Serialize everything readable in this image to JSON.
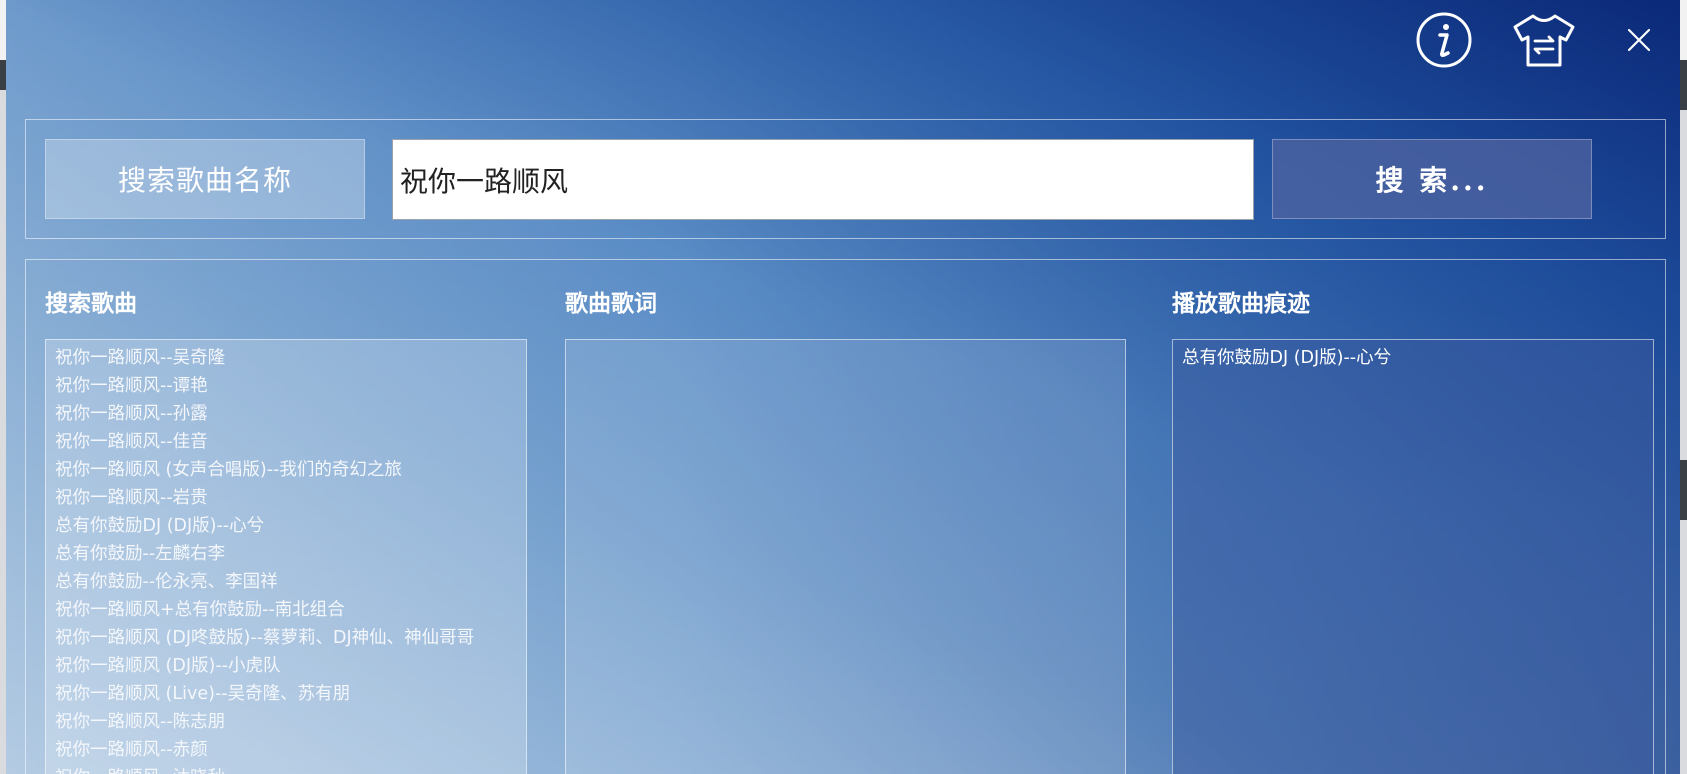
{
  "toolbar": {
    "info_icon": "info-icon",
    "skin_icon": "tshirt-skin-icon",
    "close_icon": "close-icon"
  },
  "search": {
    "label": "搜索歌曲名称",
    "value": "祝你一路顺风",
    "button": "搜 索..."
  },
  "results": {
    "title": "搜索歌曲",
    "items": [
      "祝你一路顺风--吴奇隆",
      "祝你一路顺风--谭艳",
      "祝你一路顺风--孙露",
      "祝你一路顺风--佳音",
      "祝你一路顺风 (女声合唱版)--我们的奇幻之旅",
      "祝你一路顺风--岩贵",
      "总有你鼓励DJ (DJ版)--心兮",
      "总有你鼓励--左麟右李",
      "总有你鼓励--伦永亮、李国祥",
      "祝你一路顺风+总有你鼓励--南北组合",
      "祝你一路顺风 (DJ咚鼓版)--蔡萝莉、DJ神仙、神仙哥哥",
      "祝你一路顺风 (DJ版)--小虎队",
      "祝你一路顺风 (Live)--吴奇隆、苏有朋",
      "祝你一路顺风--陈志朋",
      "祝你一路顺风--赤颜",
      "祝你一路顺风--沐晓秋"
    ]
  },
  "lyrics": {
    "title": "歌曲歌词"
  },
  "history": {
    "title": "播放歌曲痕迹",
    "items": [
      "总有你鼓励DJ (DJ版)--心兮"
    ]
  }
}
